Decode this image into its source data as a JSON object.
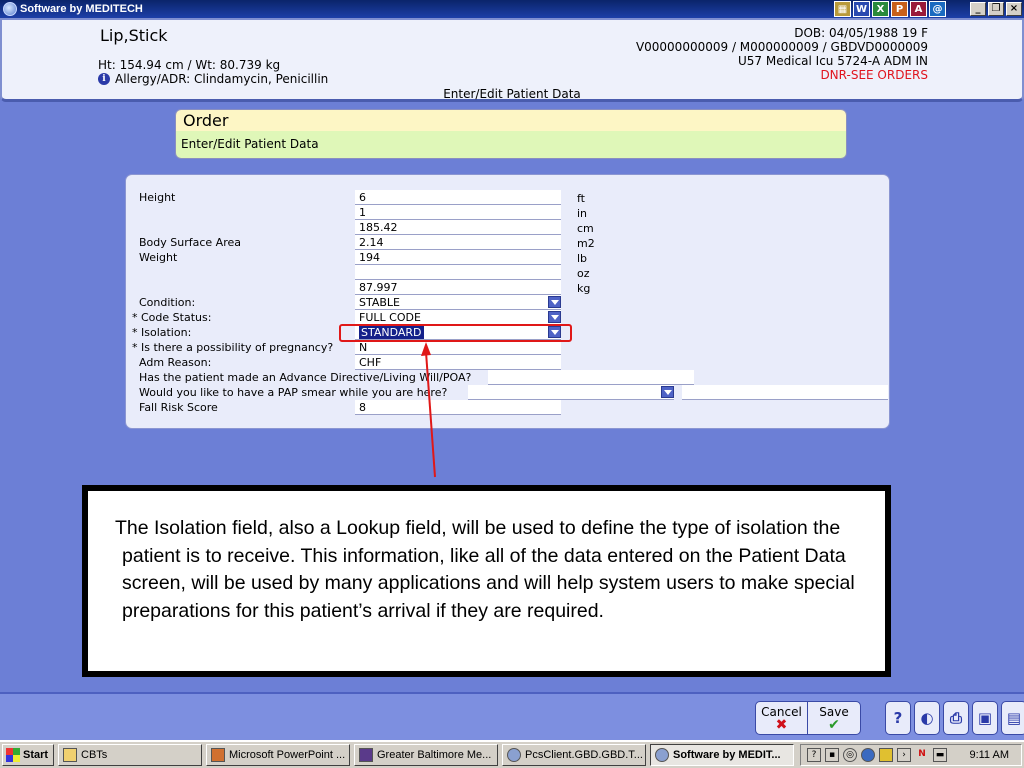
{
  "window": {
    "title": "Software by MEDITECH"
  },
  "title_tools": [
    "W",
    "X",
    "P",
    "A",
    "@"
  ],
  "patient": {
    "name": "Lip,Stick",
    "ht_wt": "Ht: 154.94 cm / Wt: 80.739 kg",
    "allergy": "Allergy/ADR: Clindamycin, Penicillin",
    "dob": "DOB: 04/05/1988 19 F",
    "ids": "V00000000009 / M000000009 / GBDVD0000009",
    "location": "U57 Medical Icu  5724-A  ADM IN",
    "alert": "DNR-SEE ORDERS",
    "screen": "Enter/Edit Patient Data"
  },
  "order": {
    "title": "Order",
    "subtitle": "Enter/Edit Patient Data"
  },
  "form": {
    "height_label": "Height",
    "height_ft": "6",
    "unit_ft": "ft",
    "height_in": "1",
    "unit_in": "in",
    "height_cm": "185.42",
    "unit_cm": "cm",
    "bsa_label": "Body Surface Area",
    "bsa": "2.14",
    "unit_m2": "m2",
    "weight_label": "Weight",
    "weight_lb": "194",
    "unit_lb": "lb",
    "weight_oz": "",
    "unit_oz": "oz",
    "weight_kg": "87.997",
    "unit_kg": "kg",
    "condition_label": "Condition:",
    "condition": "STABLE",
    "code_label": "* Code Status:",
    "code": "FULL CODE",
    "isolation_label": "* Isolation:",
    "isolation": "STANDARD",
    "pregnancy_label": "* Is there a possibility of pregnancy?",
    "pregnancy": "N",
    "adm_label": "Adm Reason:",
    "adm": "CHF",
    "directive_label": "Has the patient made an Advance Directive/Living Will/POA?",
    "directive": "",
    "pap_label": "Would you like to have a PAP smear while you are here?",
    "pap": "",
    "pap_extra": "",
    "fall_label": "Fall Risk Score",
    "fall": "8"
  },
  "callout": {
    "text": "The Isolation field, also a Lookup field, will be used to define the type of isolation the patient is to receive. This information, like all of the data entered on the Patient Data screen, will be used by many applications and will help system users to make special preparations for this patient’s arrival if they are required."
  },
  "actions": {
    "cancel": "Cancel",
    "cancel_mark": "✖",
    "save": "Save",
    "save_mark": "✔"
  },
  "footer_icons": {
    "help": "?"
  },
  "taskbar": {
    "start": "Start",
    "tasks": [
      "CBTs",
      "Microsoft PowerPoint ...",
      "Greater Baltimore Me...",
      "PcsClient.GBD.GBD.T...",
      "Software by MEDIT..."
    ],
    "clock": "9:11 AM"
  }
}
